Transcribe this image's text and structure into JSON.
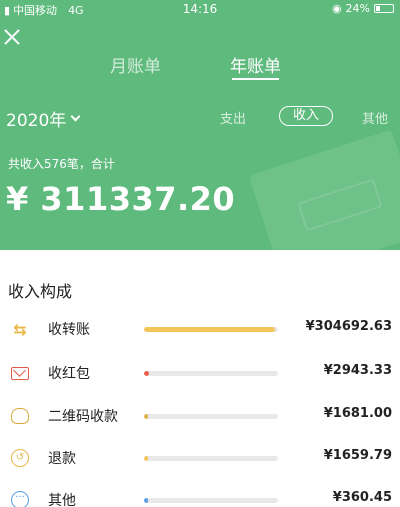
{
  "status_bar": {
    "carrier": "中国移动",
    "network": "4G",
    "time": "14:16",
    "battery_text": "24%",
    "battery_level": 0.24
  },
  "header": {
    "tabs": [
      {
        "label": "月账单",
        "active": false
      },
      {
        "label": "年账单",
        "active": true
      }
    ],
    "year_label": "2020年",
    "filters": [
      {
        "label": "支出",
        "active": false
      },
      {
        "label": "收入",
        "active": true
      },
      {
        "label": "其他",
        "active": false
      }
    ],
    "summary": "共收入576笔，合计",
    "total_amount": "¥ 311337.20",
    "accent_color": "#5fba7d"
  },
  "breakdown": {
    "title": "收入构成",
    "items": [
      {
        "name": "收转账",
        "icon": "transfer-icon",
        "amount": "¥304692.63",
        "share": 0.979,
        "color": "#f2c65a"
      },
      {
        "name": "收红包",
        "icon": "red-envelope-icon",
        "amount": "¥2943.33",
        "share": 0.04,
        "color": "#e8604c"
      },
      {
        "name": "二维码收款",
        "icon": "money-bag-icon",
        "amount": "¥1681.00",
        "share": 0.03,
        "color": "#e0b04a"
      },
      {
        "name": "退款",
        "icon": "refund-icon",
        "amount": "¥1659.79",
        "share": 0.03,
        "color": "#f2c65a"
      },
      {
        "name": "其他",
        "icon": "more-icon",
        "amount": "¥360.45",
        "share": 0.03,
        "color": "#5b9ee8"
      }
    ]
  }
}
